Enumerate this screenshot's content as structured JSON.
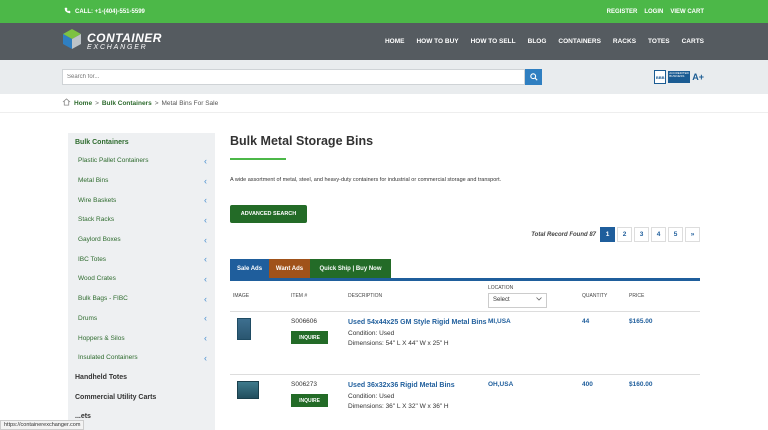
{
  "topbar": {
    "phone": "CALL: +1-(404)-551-5599",
    "links": [
      "REGISTER",
      "LOGIN",
      "VIEW CART"
    ]
  },
  "logo": {
    "line1": "CONTAINER",
    "line2": "EXCHANGER"
  },
  "nav": [
    "HOME",
    "HOW TO BUY",
    "HOW TO SELL",
    "BLOG",
    "CONTAINERS",
    "RACKS",
    "TOTES",
    "CARTS"
  ],
  "search": {
    "placeholder": "Search for..."
  },
  "bbb": {
    "logo_text": "BBB",
    "badge": "ACCREDITED BUSINESS",
    "grade": "A+"
  },
  "breadcrumb": {
    "home": "Home",
    "sep": ">",
    "parent": "Bulk Containers",
    "current": "Metal Bins For Sale"
  },
  "sidebar": {
    "heading": "Bulk Containers",
    "items": [
      "Plastic Pallet Containers",
      "Metal Bins",
      "Wire Baskets",
      "Stack Racks",
      "Gaylord Boxes",
      "IBC Totes",
      "Wood Crates",
      "Bulk Bags - FIBC",
      "Drums",
      "Hoppers & Silos",
      "Insulated Containers"
    ],
    "sections": [
      "Handheld Totes",
      "Commercial Utility Carts",
      "...ets"
    ]
  },
  "main": {
    "title": "Bulk Metal Storage Bins",
    "description": "A wide assortment of metal, steel, and heavy-duty containers for industrial or commercial storage and transport.",
    "advanced_search": "ADVANCED SEARCH",
    "total_records": "Total Record Found 87",
    "pages": [
      "1",
      "2",
      "3",
      "4",
      "5",
      "»"
    ]
  },
  "tabs": [
    "Sale Ads",
    "Want Ads",
    "Quick Ship | Buy Now"
  ],
  "table": {
    "headers": {
      "image": "IMAGE",
      "item": "ITEM #",
      "description": "DESCRIPTION",
      "location": "LOCATION",
      "quantity": "QUANTITY",
      "price": "PRICE"
    },
    "location_select": "Select",
    "inquire_label": "INQUIRE",
    "rows": [
      {
        "item": "S006606",
        "title": "Used 54x44x25 GM Style Rigid Metal Bins",
        "condition": "Condition: Used",
        "dimensions": "Dimensions: 54\" L X 44\" W x 25\" H",
        "location": "MI,USA",
        "quantity": "44",
        "price": "$165.00"
      },
      {
        "item": "S006273",
        "title": "Used 36x32x36 Rigid Metal Bins",
        "condition": "Condition: Used",
        "dimensions": "Dimensions: 36\" L X 32\" W x 36\" H",
        "location": "OH,USA",
        "quantity": "400",
        "price": "$160.00"
      }
    ]
  },
  "status_url": "https://containerexchanger.com"
}
